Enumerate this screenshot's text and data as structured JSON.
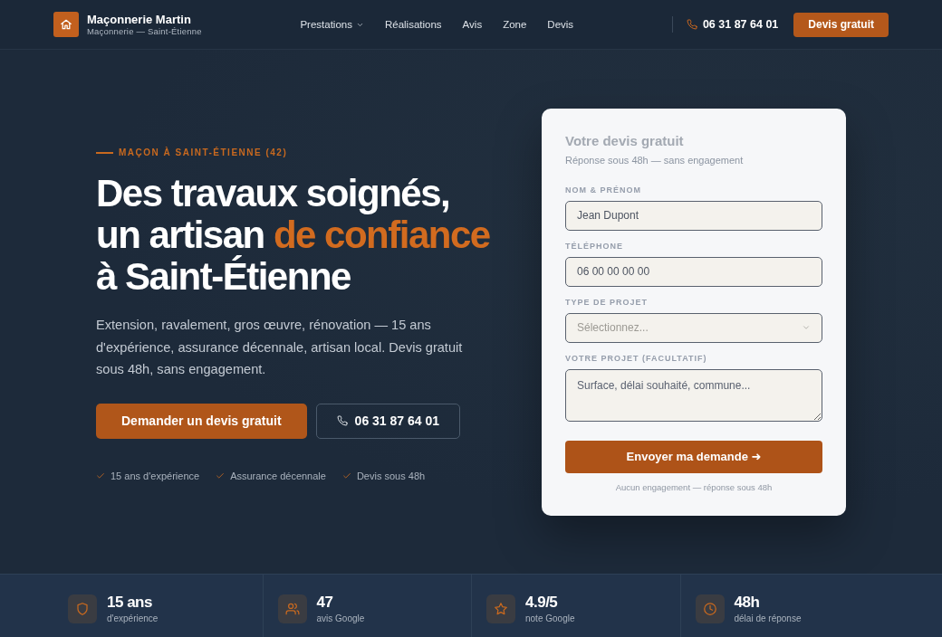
{
  "header": {
    "brand": {
      "name": "Maçonnerie Martin",
      "tagline": "Maçonnerie — Saint-Étienne"
    },
    "nav": [
      {
        "label": "Prestations",
        "kind": "dropdown"
      },
      {
        "label": "Réalisations",
        "kind": "link"
      },
      {
        "label": "Avis",
        "kind": "link"
      },
      {
        "label": "Zone",
        "kind": "link"
      },
      {
        "label": "Devis",
        "kind": "link"
      }
    ],
    "phone": "06 31 87 64 01",
    "cta": "Devis gratuit"
  },
  "hero": {
    "eyebrow": "MAÇON À SAINT-ÉTIENNE (42)",
    "headline": [
      [
        {
          "text": "Des travaux soignés,",
          "accent": false
        }
      ],
      [
        {
          "text": "un artisan ",
          "accent": false
        },
        {
          "text": "de confiance",
          "accent": true
        }
      ],
      [
        {
          "text": "à Saint-Étienne",
          "accent": false
        }
      ]
    ],
    "intro": "Extension, ravalement, gros œuvre, rénovation — 15 ans d'expérience, assurance décennale, artisan local. Devis gratuit sous 48h, sans engagement.",
    "primary_button": "Demander un devis gratuit",
    "phone_button": "06 31 87 64 01",
    "highlights": [
      "15 ans d'expérience",
      "Assurance décennale",
      "Devis sous 48h"
    ]
  },
  "quote_form": {
    "title": "Votre devis gratuit",
    "subtitle": "Réponse sous 48h — sans engagement",
    "fields": [
      {
        "label": "NOM & PRÉNOM",
        "kind": "text",
        "placeholder": "Jean Dupont"
      },
      {
        "label": "TÉLÉPHONE",
        "kind": "text",
        "placeholder": "06 00 00 00 00"
      },
      {
        "label": "TYPE DE PROJET",
        "kind": "select",
        "placeholder": "Sélectionnez..."
      },
      {
        "label": "VOTRE PROJET (FACULTATIF)",
        "kind": "textarea",
        "placeholder": "Surface, délai souhaité, commune..."
      }
    ],
    "submit": "Envoyer ma demande ➜",
    "note": "Aucun engagement — réponse sous 48h"
  },
  "stats": [
    {
      "kind": "shield",
      "value": "15 ans",
      "label": "d'expérience"
    },
    {
      "kind": "users",
      "value": "47",
      "label": "avis Google"
    },
    {
      "kind": "star",
      "value": "4.9/5",
      "label": "note Google"
    },
    {
      "kind": "clock",
      "value": "48h",
      "label": "délai de réponse"
    }
  ]
}
